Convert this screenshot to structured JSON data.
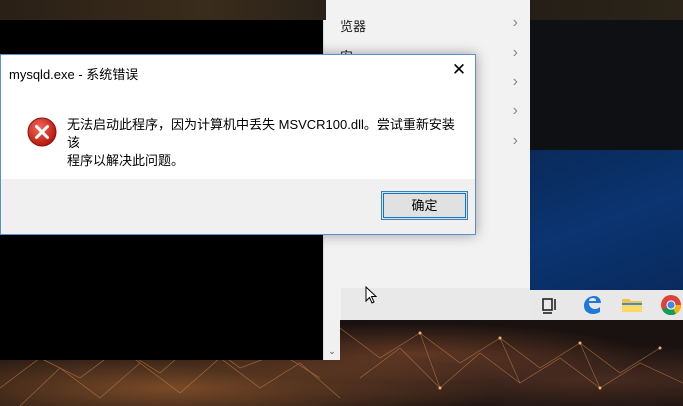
{
  "dialog": {
    "title": "mysqld.exe - 系统错误",
    "close_glyph": "✕",
    "message_line1": "无法启动此程序，因为计算机中丢失 MSVCR100.dll。尝试重新安装该",
    "message_line2": "程序以解决此问题。",
    "ok_label": "确定",
    "icon": "error-icon"
  },
  "start_menu": {
    "items": [
      {
        "label": "览器",
        "chevron": "›"
      },
      {
        "label": "安",
        "chevron": "›"
      },
      {
        "label": "",
        "chevron": "›"
      },
      {
        "label": "",
        "chevron": "›"
      },
      {
        "label": "",
        "chevron": "›"
      }
    ]
  },
  "taskbar": {
    "icons": [
      "task-view-icon",
      "edge-icon",
      "file-explorer-icon",
      "chrome-icon"
    ]
  },
  "console": {
    "scroll_down_glyph": "⌄"
  },
  "colors": {
    "accent": "#0078d7",
    "error_red": "#c42b1c",
    "dialog_border": "#5d8fcf"
  }
}
